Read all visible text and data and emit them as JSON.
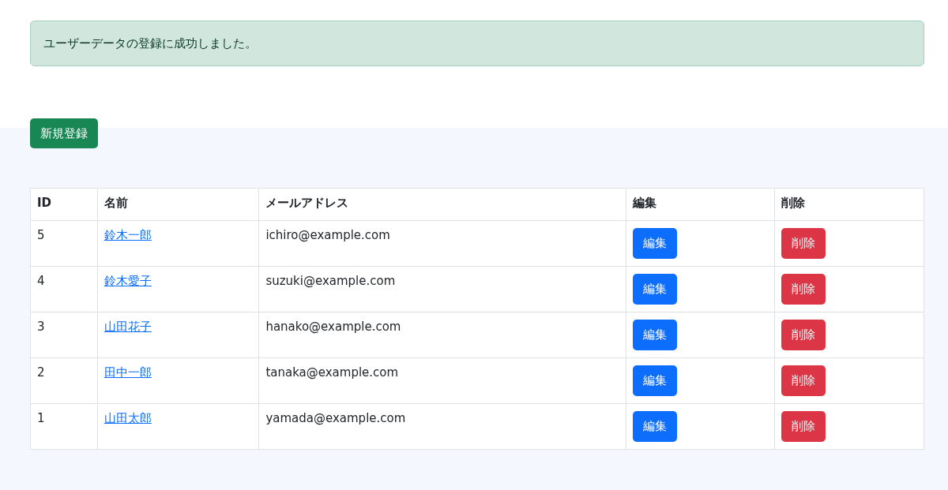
{
  "alert": {
    "message": "ユーザーデータの登録に成功しました。"
  },
  "new_button": {
    "label": "新規登録"
  },
  "table": {
    "columns": [
      "ID",
      "名前",
      "メールアドレス",
      "編集",
      "削除"
    ],
    "rows": [
      {
        "id": "5",
        "name": "鈴木一郎",
        "email": "ichiro@example.com",
        "edit": "編集",
        "delete": "削除"
      },
      {
        "id": "4",
        "name": "鈴木愛子",
        "email": "suzuki@example.com",
        "edit": "編集",
        "delete": "削除"
      },
      {
        "id": "3",
        "name": "山田花子",
        "email": "hanako@example.com",
        "edit": "編集",
        "delete": "削除"
      },
      {
        "id": "2",
        "name": "田中一郎",
        "email": "tanaka@example.com",
        "edit": "編集",
        "delete": "削除"
      },
      {
        "id": "1",
        "name": "山田太郎",
        "email": "yamada@example.com",
        "edit": "編集",
        "delete": "削除"
      }
    ]
  }
}
